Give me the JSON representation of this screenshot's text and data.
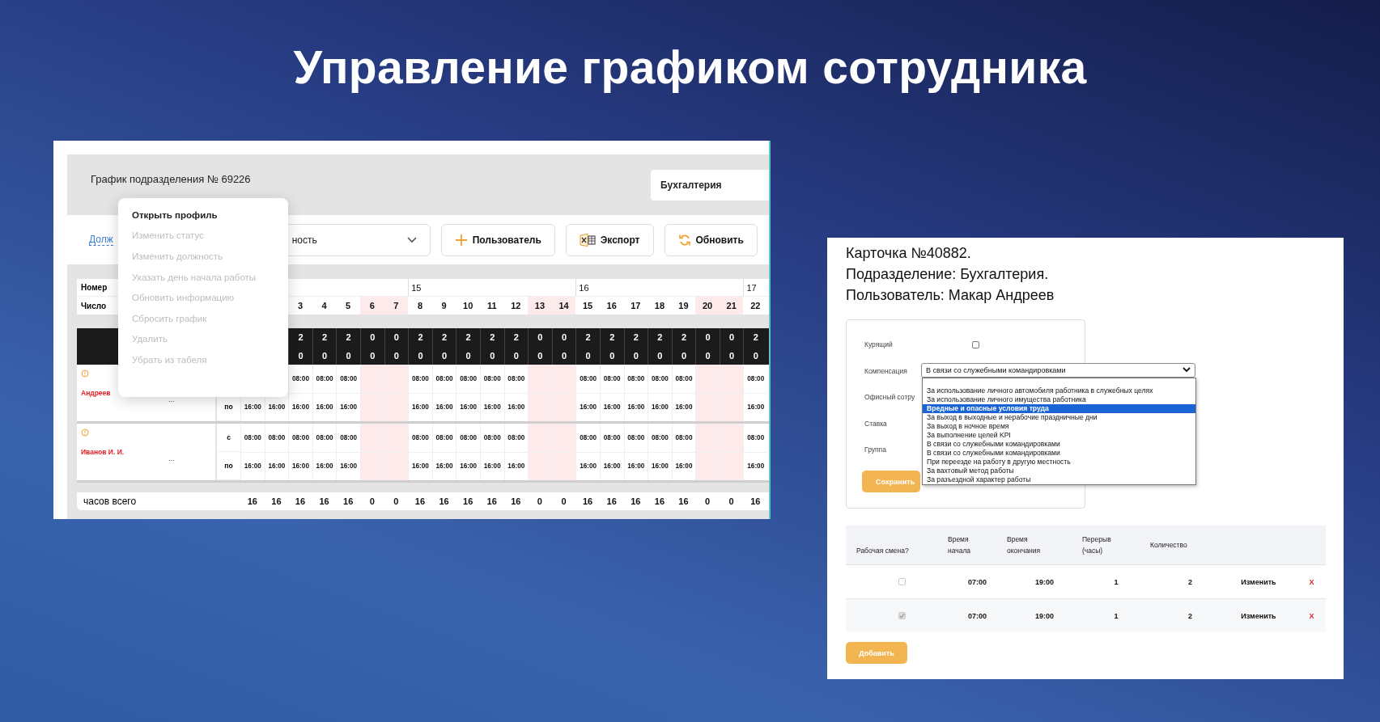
{
  "heading": "Управление графиком сотрудника",
  "schedule": {
    "title": "График подразделения № 69226",
    "department": "Бухгалтерия",
    "position_link": "Долж",
    "position_select": "ность",
    "buttons": [
      {
        "kind": "add",
        "label": "Пользователь"
      },
      {
        "kind": "export",
        "label": "Экспорт"
      },
      {
        "kind": "refresh",
        "label": "Обновить"
      }
    ],
    "week_header": "Номер",
    "day_header": "Число",
    "days": [
      {
        "number": "3",
        "weekend": false
      },
      {
        "number": "4",
        "weekend": false
      },
      {
        "number": "5",
        "weekend": false
      },
      {
        "number": "6",
        "weekend": true
      },
      {
        "number": "7",
        "weekend": true
      },
      {
        "number": "8",
        "weekend": false,
        "week": "15"
      },
      {
        "number": "9",
        "weekend": false
      },
      {
        "number": "10",
        "weekend": false
      },
      {
        "number": "11",
        "weekend": false
      },
      {
        "number": "12",
        "weekend": false
      },
      {
        "number": "13",
        "weekend": true
      },
      {
        "number": "14",
        "weekend": true
      },
      {
        "number": "15",
        "weekend": false,
        "week": "16"
      },
      {
        "number": "16",
        "weekend": false
      },
      {
        "number": "17",
        "weekend": false
      },
      {
        "number": "18",
        "weekend": false
      },
      {
        "number": "19",
        "weekend": false
      },
      {
        "number": "20",
        "weekend": true
      },
      {
        "number": "21",
        "weekend": true
      },
      {
        "number": "22",
        "weekend": false,
        "week": "17"
      }
    ],
    "norm_rows": [
      {
        "values": [
          "2",
          "2",
          "2",
          "0",
          "0",
          "2",
          "2",
          "2",
          "2",
          "2",
          "0",
          "0",
          "2",
          "2",
          "2",
          "2",
          "2",
          "0",
          "0",
          "2"
        ]
      },
      {
        "values": [
          "0",
          "0",
          "0",
          "0",
          "0",
          "0",
          "0",
          "0",
          "0",
          "0",
          "0",
          "0",
          "0",
          "0",
          "0",
          "0",
          "0",
          "0",
          "0",
          "0"
        ]
      }
    ],
    "employees": [
      {
        "name": "Андреев",
        "warning": true,
        "more": "...",
        "to_label": "по",
        "days": [
          {
            "end": "16:00",
            "day_off": false
          },
          {
            "end": "16:00",
            "day_off": false
          },
          {
            "start": "08:00",
            "end": "16:00",
            "day_off": false
          },
          {
            "start": "08:00",
            "end": "16:00",
            "day_off": false
          },
          {
            "start": "08:00",
            "end": "16:00",
            "day_off": false
          },
          {
            "day_off": true
          },
          {
            "day_off": true
          },
          {
            "start": "08:00",
            "end": "16:00",
            "day_off": false
          },
          {
            "start": "08:00",
            "end": "16:00",
            "day_off": false
          },
          {
            "start": "08:00",
            "end": "16:00",
            "day_off": false
          },
          {
            "start": "08:00",
            "end": "16:00",
            "day_off": false
          },
          {
            "start": "08:00",
            "end": "16:00",
            "day_off": false
          },
          {
            "day_off": true
          },
          {
            "day_off": true
          },
          {
            "start": "08:00",
            "end": "16:00",
            "day_off": false
          },
          {
            "start": "08:00",
            "end": "16:00",
            "day_off": false
          },
          {
            "start": "08:00",
            "end": "16:00",
            "day_off": false
          },
          {
            "start": "08:00",
            "end": "16:00",
            "day_off": false
          },
          {
            "start": "08:00",
            "end": "16:00",
            "day_off": false
          },
          {
            "day_off": true
          },
          {
            "day_off": true
          },
          {
            "start": "08:00",
            "end": "16:00",
            "day_off": false
          }
        ]
      },
      {
        "name": "Иванов И. И.",
        "warning": true,
        "more": "...",
        "from_label": "с",
        "to_label": "по",
        "days": [
          {
            "start": "08:00",
            "end": "16:00",
            "day_off": false
          },
          {
            "start": "08:00",
            "end": "16:00",
            "day_off": false
          },
          {
            "start": "08:00",
            "end": "16:00",
            "day_off": false
          },
          {
            "start": "08:00",
            "end": "16:00",
            "day_off": false
          },
          {
            "start": "08:00",
            "end": "16:00",
            "day_off": false
          },
          {
            "day_off": true
          },
          {
            "day_off": true
          },
          {
            "start": "08:00",
            "end": "16:00",
            "day_off": false
          },
          {
            "start": "08:00",
            "end": "16:00",
            "day_off": false
          },
          {
            "start": "08:00",
            "end": "16:00",
            "day_off": false
          },
          {
            "start": "08:00",
            "end": "16:00",
            "day_off": false
          },
          {
            "start": "08:00",
            "end": "16:00",
            "day_off": false
          },
          {
            "day_off": true
          },
          {
            "day_off": true
          },
          {
            "start": "08:00",
            "end": "16:00",
            "day_off": false
          },
          {
            "start": "08:00",
            "end": "16:00",
            "day_off": false
          },
          {
            "start": "08:00",
            "end": "16:00",
            "day_off": false
          },
          {
            "start": "08:00",
            "end": "16:00",
            "day_off": false
          },
          {
            "start": "08:00",
            "end": "16:00",
            "day_off": false
          },
          {
            "day_off": true
          },
          {
            "day_off": true
          },
          {
            "start": "08:00",
            "end": "16:00",
            "day_off": false
          }
        ]
      }
    ],
    "totals_label": "часов всего",
    "totals": [
      "16",
      "16",
      "16",
      "16",
      "16",
      "0",
      "0",
      "16",
      "16",
      "16",
      "16",
      "16",
      "0",
      "0",
      "16",
      "16",
      "16",
      "16",
      "16",
      "0",
      "0",
      "16"
    ],
    "context_menu": [
      {
        "label": "Открыть профиль",
        "disabled": false
      },
      {
        "label": "Изменить статус",
        "disabled": true
      },
      {
        "label": "Изменить должность",
        "disabled": true
      },
      {
        "label": "Указать день начала работы",
        "disabled": true
      },
      {
        "label": "Обновить информацию",
        "disabled": true
      },
      {
        "label": "Сбросить график",
        "disabled": true
      },
      {
        "label": "Удалить",
        "disabled": true
      },
      {
        "label": "Убрать из табеля",
        "disabled": true
      }
    ]
  },
  "card": {
    "lines": [
      "Карточка №40882.",
      "Подразделение: Бухгалтерия.",
      "Пользователь: Макар Андреев"
    ],
    "fields": [
      {
        "kind": "checkbox",
        "label": "Курящий",
        "checked": false
      },
      {
        "kind": "select",
        "label": "Компенсация",
        "value": "В связи со служебными командировками"
      },
      {
        "kind": "plain",
        "label": "Офисный сотру"
      },
      {
        "kind": "plain",
        "label": "Ставка"
      },
      {
        "kind": "plain",
        "label": "Группа"
      }
    ],
    "options": [
      {
        "label": "За использование личного автомобиля работника в служебных целях",
        "selected": false
      },
      {
        "label": "За использование личного имущества работника",
        "selected": false
      },
      {
        "label": "Вредные и опасные условия труда",
        "selected": true
      },
      {
        "label": "За выход в выходные и нерабочие праздничные дни",
        "selected": false
      },
      {
        "label": "За выход в ночное время",
        "selected": false
      },
      {
        "label": "За выполнение целей KPI",
        "selected": false
      },
      {
        "label": "В связи со служебными командировками",
        "selected": false
      },
      {
        "label": "В связи со служебными командировками",
        "selected": false
      },
      {
        "label": "При переезде на работу в другую местность",
        "selected": false
      },
      {
        "label": "За вахтовый метод работы",
        "selected": false
      },
      {
        "label": "За разъездной характер работы",
        "selected": false
      }
    ],
    "save_button": "Сохранить",
    "columns": [
      "Рабочая смена?",
      "Время начала",
      "Время окончания",
      "Перерыв (часы)",
      "Количество"
    ],
    "shifts": [
      {
        "working": false,
        "start": "07:00",
        "end": "19:00",
        "break": "1",
        "count": "2",
        "edit": "Изменить",
        "delete": "X"
      },
      {
        "working": true,
        "start": "07:00",
        "end": "19:00",
        "break": "1",
        "count": "2",
        "edit": "Изменить",
        "delete": "X"
      }
    ],
    "add_button": "Добавить"
  }
}
